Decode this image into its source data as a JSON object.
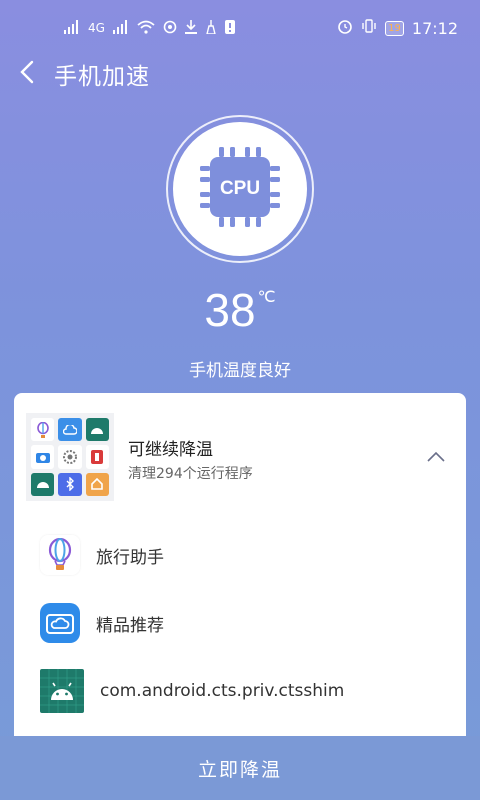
{
  "statusbar": {
    "signal1": "×",
    "network": "4G",
    "time": "17:12",
    "battery": "19"
  },
  "header": {
    "title": "手机加速"
  },
  "cpu": {
    "label": "CPU",
    "temperature": "38",
    "unit": "℃",
    "status": "手机温度良好"
  },
  "card": {
    "title": "可继续降温",
    "subtitle": "清理294个运行程序",
    "apps": [
      {
        "name": "旅行助手",
        "icon": "balloon-icon"
      },
      {
        "name": "精品推荐",
        "icon": "cloud-folder-icon"
      },
      {
        "name": "com.android.cts.priv.ctsshim",
        "icon": "android-icon"
      }
    ]
  },
  "action": {
    "label": "立即降温"
  },
  "colors": {
    "accent": "#7e8fdc",
    "card": "#ffffff",
    "button": "#7b99d6"
  }
}
